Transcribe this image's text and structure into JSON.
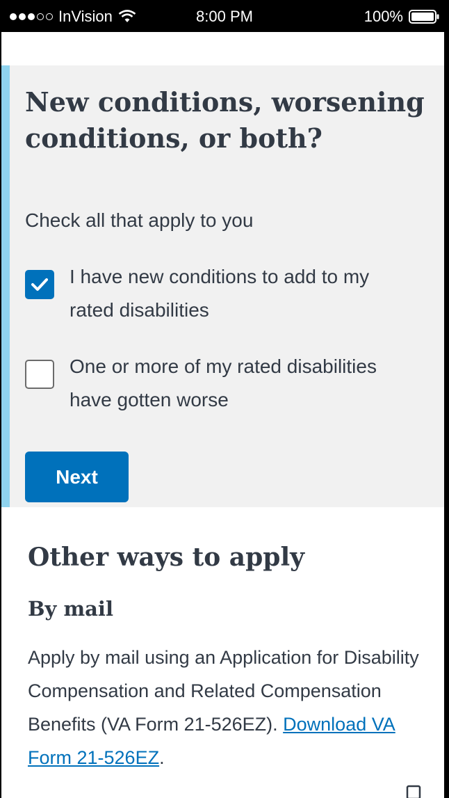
{
  "status_bar": {
    "carrier": "InVision",
    "time": "8:00 PM",
    "battery": "100%"
  },
  "question": {
    "title": "New conditions, worsening conditions, or both?",
    "hint": "Check all that apply to you",
    "options": [
      {
        "label": "I have new conditions to add to my rated disabilities",
        "checked": true
      },
      {
        "label": "One or more of my rated disabilities have gotten worse",
        "checked": false
      }
    ],
    "next_label": "Next"
  },
  "other_ways": {
    "title": "Other ways to apply",
    "mail_title": "By mail",
    "mail_text": "Apply by mail using an Application for Disability Compensation and Related Compensation Benefits (VA Form 21-526EZ).",
    "mail_link": "Download VA Form 21-526EZ",
    "mail_text_end": "."
  },
  "colors": {
    "accent": "#0071bb",
    "panel": "#f1f1f1",
    "panel_border": "#8fd3ee",
    "text": "#323a45"
  }
}
